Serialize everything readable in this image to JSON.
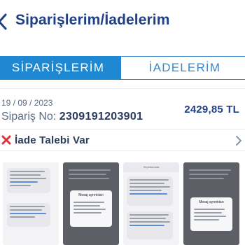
{
  "header": {
    "title": "Siparişlerim/İadelerim"
  },
  "tabs": [
    {
      "label": "SİPARİŞLERİM",
      "active": true
    },
    {
      "label": "İADELERİM",
      "active": false
    }
  ],
  "order": {
    "date": "19 / 09 / 2023",
    "number_label": "Sipariş No:",
    "number": "2309191203901",
    "amount": "2429,85 TL"
  },
  "return_status": {
    "label": "İade Talebi Var"
  },
  "attachments": [
    {
      "kind": "sms-screenshot"
    },
    {
      "kind": "message-details",
      "title": "Mesaj ayrıntıları"
    },
    {
      "kind": "sms-screenshot",
      "header": "Hepsiburada"
    },
    {
      "kind": "message-details",
      "title": "Mesaj ayrıntıları"
    }
  ],
  "colors": {
    "title": "#1f3f86",
    "tab_active_bg": "#1f88d2",
    "tab_border": "#2f80c8",
    "close_icon": "#d9323a"
  }
}
